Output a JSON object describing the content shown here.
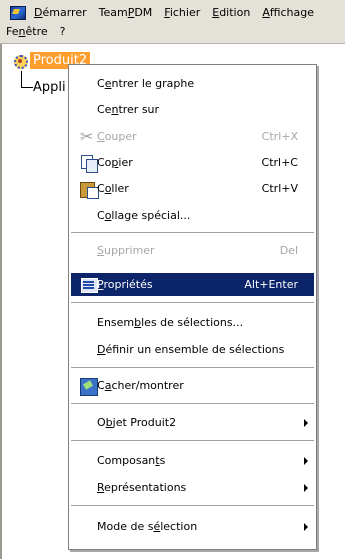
{
  "menubar": {
    "row1": [
      "Démarrer",
      "TeamPDM",
      "Fichier",
      "Edition",
      "Affichage"
    ],
    "row2": [
      "Fenêtre",
      "?"
    ]
  },
  "tree": {
    "root_label": "Produit2",
    "child_label": "Appli"
  },
  "context_menu": {
    "items": [
      {
        "label": "Centrer le graphe",
        "shortcut": "",
        "state": "normal"
      },
      {
        "label": "Centrer sur",
        "shortcut": "",
        "state": "normal"
      },
      {
        "label": "Couper",
        "shortcut": "Ctrl+X",
        "state": "disabled",
        "icon": "scissors-icon"
      },
      {
        "label": "Copier",
        "shortcut": "Ctrl+C",
        "state": "normal",
        "icon": "copy-icon"
      },
      {
        "label": "Coller",
        "shortcut": "Ctrl+V",
        "state": "normal",
        "icon": "paste-icon"
      },
      {
        "label": "Collage spécial...",
        "shortcut": "",
        "state": "normal"
      },
      {
        "label": "Supprimer",
        "shortcut": "Del",
        "state": "disabled"
      },
      {
        "label": "Propriétés",
        "shortcut": "Alt+Enter",
        "state": "selected",
        "icon": "properties-icon"
      },
      {
        "label": "Ensembles de sélections...",
        "shortcut": "",
        "state": "normal"
      },
      {
        "label": "Définir un ensemble de sélections",
        "shortcut": "",
        "state": "normal"
      },
      {
        "label": "Cacher/montrer",
        "shortcut": "",
        "state": "normal",
        "icon": "hide-show-icon"
      },
      {
        "label": "Objet Produit2",
        "shortcut": "",
        "state": "submenu"
      },
      {
        "label": "Composants",
        "shortcut": "",
        "state": "submenu"
      },
      {
        "label": "Représentations",
        "shortcut": "",
        "state": "submenu"
      },
      {
        "label": "Mode de sélection",
        "shortcut": "",
        "state": "submenu"
      }
    ]
  },
  "colors": {
    "menubar_bg": "#e4e1d8",
    "selection_bg": "#0b246a",
    "root_highlight": "#ff9d2e",
    "disabled_text": "#a7a7a7"
  }
}
